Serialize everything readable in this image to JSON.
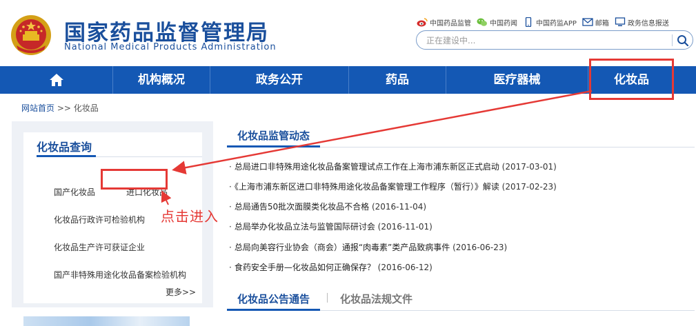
{
  "header": {
    "title_cn": "国家药品监督管理局",
    "title_en": "National Medical Products Administration",
    "top_links": [
      {
        "label": "中国药品监管",
        "icon": "weibo-icon"
      },
      {
        "label": "中国药闻",
        "icon": "wechat-icon"
      },
      {
        "label": "中国药监APP",
        "icon": "phone-icon"
      },
      {
        "label": "邮箱",
        "icon": "mail-icon"
      },
      {
        "label": "政务信息报送",
        "icon": "monitor-icon"
      }
    ],
    "search_placeholder": "正在建设中..."
  },
  "nav": {
    "items": [
      {
        "label": "机构概况"
      },
      {
        "label": "政务公开"
      },
      {
        "label": "药品"
      },
      {
        "label": "医疗器械"
      },
      {
        "label": "化妆品"
      }
    ]
  },
  "breadcrumb": {
    "home": "网站首页",
    "separator": ">>",
    "current": "化妆品"
  },
  "sidebar": {
    "title": "化妆品查询",
    "links": [
      {
        "label": "国产化妆品"
      },
      {
        "label": "进口化妆品"
      },
      {
        "label": "化妆品行政许可检验机构"
      },
      {
        "label": "化妆品生产许可获证企业"
      },
      {
        "label": "国产非特殊用途化妆品备案检验机构"
      }
    ],
    "more": "更多>>"
  },
  "dynamics": {
    "title": "化妆品监管动态",
    "items": [
      {
        "title": "总局进口非特殊用途化妆品备案管理试点工作在上海市浦东新区正式启动",
        "date": "(2017-03-01)"
      },
      {
        "title": "《上海市浦东新区进口非特殊用途化妆品备案管理工作程序（暂行）》解读",
        "date": "(2017-02-23)"
      },
      {
        "title": "总局通告50批次面膜类化妆品不合格",
        "date": "(2016-11-04)"
      },
      {
        "title": "总局举办化妆品立法与监管国际研讨会",
        "date": "(2016-11-01)"
      },
      {
        "title": "总局向美容行业协会（商会）通报“肉毒素”类产品致病事件",
        "date": "(2016-06-23)"
      },
      {
        "title": "食药安全手册—化妆品如何正确保存？",
        "date": "(2016-06-12)"
      }
    ]
  },
  "tabs": {
    "notice": "化妆品公告通告",
    "separator": "|",
    "regulations": "化妆品法规文件"
  },
  "annotation": {
    "text": "点击进入"
  },
  "colors": {
    "brand_blue": "#1458b4",
    "title_blue": "#1a4f9c",
    "annotation_red": "#e53935"
  }
}
